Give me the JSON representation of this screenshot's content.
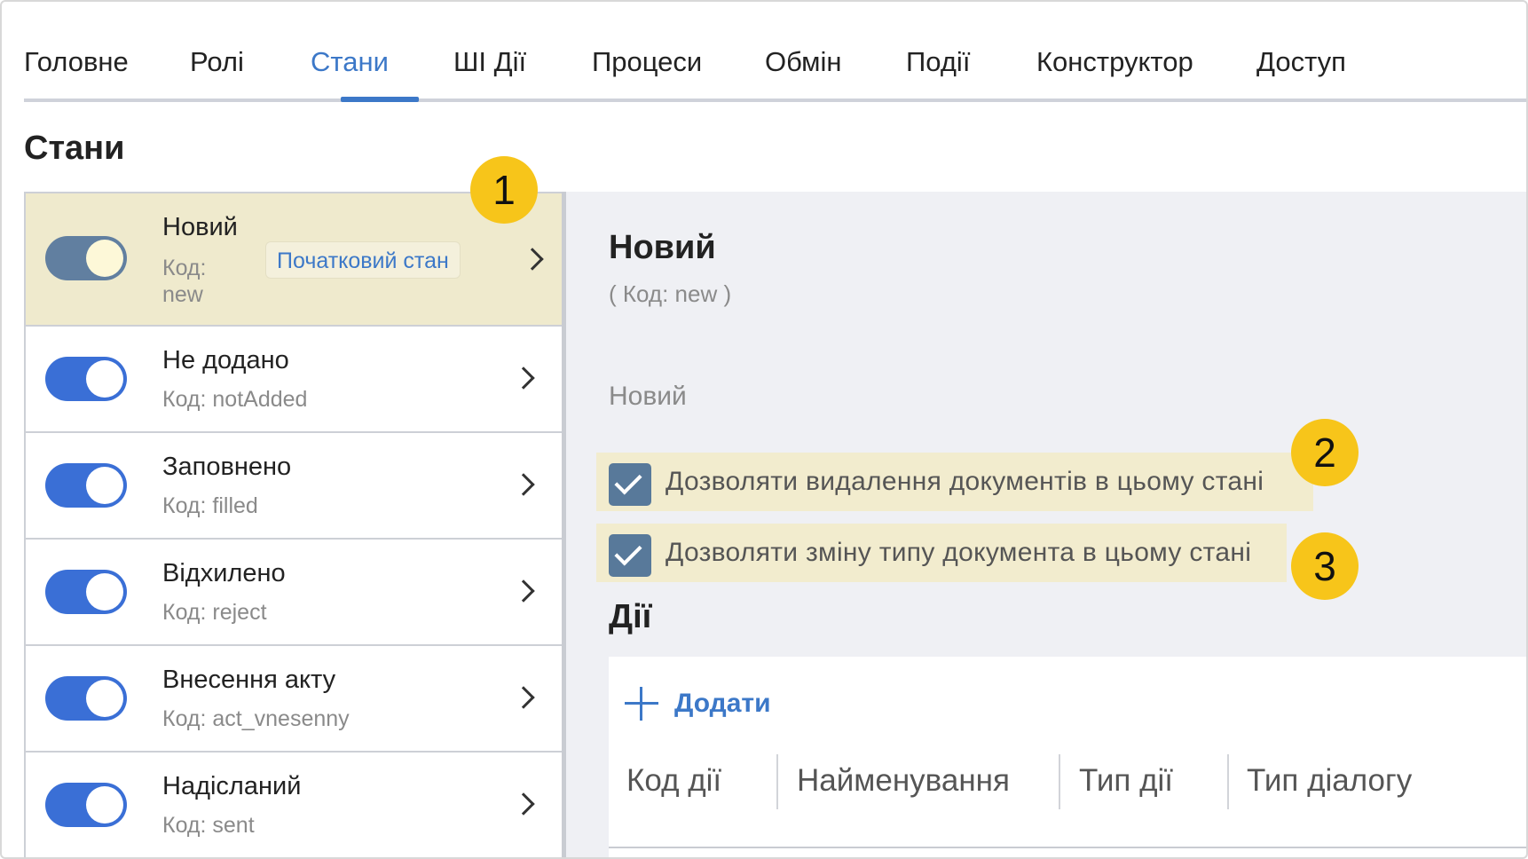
{
  "tabs": [
    {
      "label": "Головне"
    },
    {
      "label": "Ролі"
    },
    {
      "label": "Стани",
      "active": true
    },
    {
      "label": "ШІ Дії"
    },
    {
      "label": "Процеси"
    },
    {
      "label": "Обмін"
    },
    {
      "label": "Події"
    },
    {
      "label": "Конструктор"
    },
    {
      "label": "Доступ"
    }
  ],
  "page": {
    "title": "Стани"
  },
  "states": [
    {
      "name": "Новий",
      "code_label": "Код:",
      "code_value": "new",
      "badge": "Початковий стан",
      "enabled": true,
      "selected": true
    },
    {
      "name": "Не додано",
      "code": "Код: notAdded",
      "enabled": true
    },
    {
      "name": "Заповнено",
      "code": "Код: filled",
      "enabled": true
    },
    {
      "name": "Відхилено",
      "code": "Код: reject",
      "enabled": true
    },
    {
      "name": "Внесення акту",
      "code": "Код: act_vnesenny",
      "enabled": true
    },
    {
      "name": "Надісланий",
      "code": "Код: sent",
      "enabled": true
    }
  ],
  "detail": {
    "title": "Новий",
    "code": "( Код: new )",
    "description": "Новий",
    "checkboxes": [
      {
        "label": "Дозволяти видалення документів в цьому стані",
        "checked": true
      },
      {
        "label": "Дозволяти зміну типу документа в цьому стані",
        "checked": true
      }
    ],
    "actions": {
      "title": "Дії",
      "add_label": "Додати",
      "columns": [
        "Код дії",
        "Найменування",
        "Тип дії",
        "Тип діалогу"
      ]
    }
  },
  "markers": [
    "1",
    "2",
    "3"
  ],
  "colors": {
    "accent": "#3c78c8",
    "toggle_on": "#3a6fd6",
    "highlight": "#efeacd",
    "marker": "#f7c51a",
    "checkbox": "#58799a"
  }
}
